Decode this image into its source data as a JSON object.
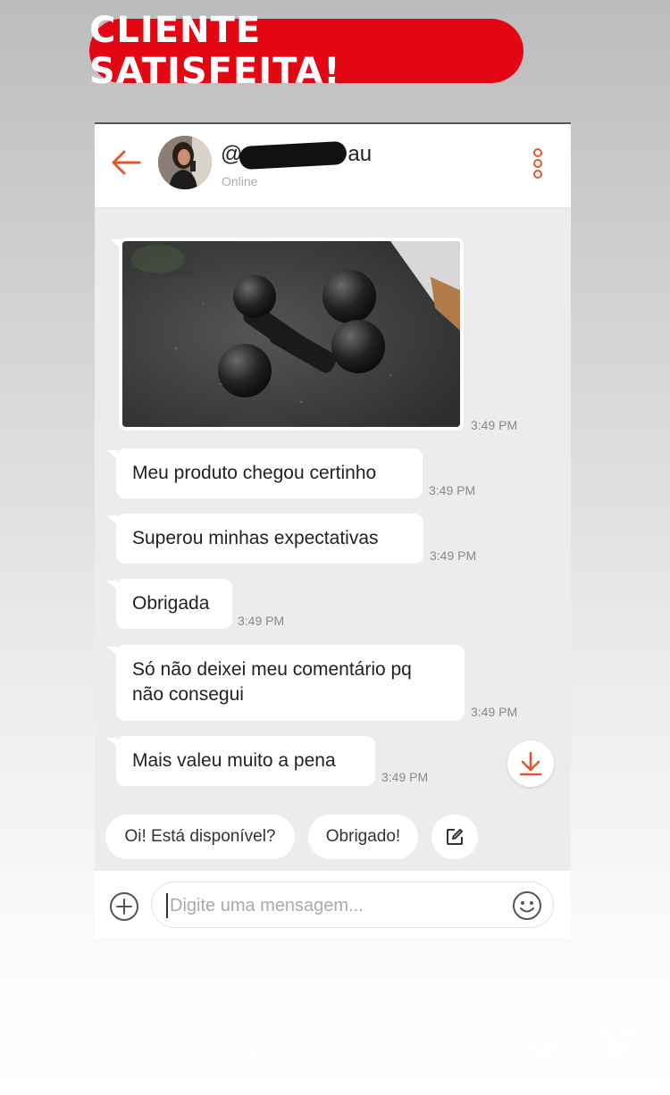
{
  "banner": {
    "text": "CLIENTE SATISFEITA!"
  },
  "header": {
    "username_prefix": "@",
    "username_suffix": "au",
    "status": "Online"
  },
  "messages": [
    {
      "type": "image",
      "image": "dumbbells-photo",
      "time": "3:49 PM"
    },
    {
      "type": "text",
      "text": "Meu produto chegou certinho",
      "time": "3:49 PM"
    },
    {
      "type": "text",
      "text": "Superou minhas expectativas",
      "time": "3:49 PM"
    },
    {
      "type": "text",
      "text": "Obrigada",
      "time": "3:49 PM"
    },
    {
      "type": "text",
      "lines": [
        "Só não deixei meu comentário pq",
        "não consegui"
      ],
      "time": "3:49 PM"
    },
    {
      "type": "text",
      "text": "Mais valeu muito a pena",
      "time": "3:49 PM"
    }
  ],
  "quick_replies": [
    "Oi! Está disponível?",
    "Obrigado!"
  ],
  "composer": {
    "placeholder": "Digite uma mensagem..."
  },
  "story_reply": {
    "placeholder": "Enviar mensagem"
  },
  "icons": {
    "back": "arrow-left-icon",
    "menu": "more-vertical-icon",
    "scroll": "arrow-down-icon",
    "edit": "edit-icon",
    "add": "plus-circle-icon",
    "emoji": "smiley-icon",
    "heart": "heart-icon",
    "send": "send-icon"
  },
  "colors": {
    "banner": "#e30613",
    "accent": "#e2572d",
    "chat_bg": "#ececec"
  }
}
